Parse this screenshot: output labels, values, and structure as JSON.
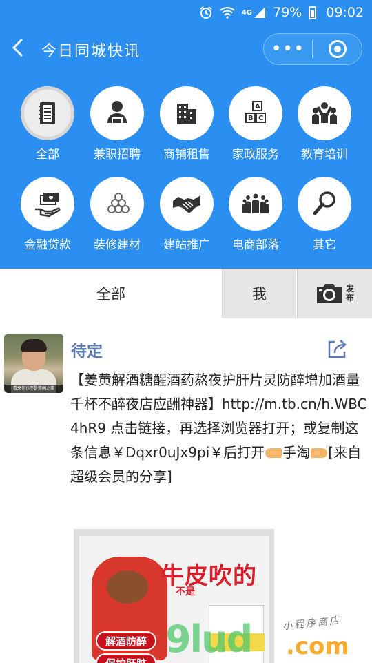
{
  "status_bar": {
    "network": "4G",
    "battery": "79%",
    "time": "09:02",
    "icons": [
      "alarm-icon",
      "wifi-icon",
      "signal-icon",
      "battery-icon"
    ]
  },
  "nav": {
    "title": "今日同城快讯",
    "more_glyph": "•••"
  },
  "categories": [
    {
      "label": "全部",
      "icon": "notebook-icon",
      "active": true
    },
    {
      "label": "兼职招聘",
      "icon": "worker-icon"
    },
    {
      "label": "商铺租售",
      "icon": "buildings-icon"
    },
    {
      "label": "家政服务",
      "icon": "abc-blocks-icon"
    },
    {
      "label": "教育培训",
      "icon": "people-cheer-icon"
    },
    {
      "label": "金融贷款",
      "icon": "money-hand-icon"
    },
    {
      "label": "装修建材",
      "icon": "pipes-icon"
    },
    {
      "label": "建站推广",
      "icon": "handshake-icon"
    },
    {
      "label": "电商部落",
      "icon": "crowd-icon"
    },
    {
      "label": "其它",
      "icon": "magnifier-icon"
    }
  ],
  "tabs": {
    "all": "全部",
    "me": "我",
    "publish": "发布"
  },
  "post": {
    "author": "待定",
    "avatar_caption": "看来你也不是等闲之辈",
    "text_before_emoji1": "【姜黄解酒糖醒酒药熬夜护肝片灵防醉增加酒量千杯不醉夜店应酬神器】http://m.tb.cn/h.WBC4hR9 点击链接，再选择浏览器打开；或复制这条信息￥Dqxr0uJx9pi￥后打开",
    "text_mid": "手淘",
    "text_after_emoji2": "[来自超级会员的分享]",
    "image": {
      "slogan_main": "牛皮吹的",
      "slogan_sub": "不是",
      "badge1": "解酒防醉",
      "badge2": "保护肝脏"
    }
  },
  "watermark": {
    "big": "9lud",
    "com": ".com",
    "small": "小程序商店"
  },
  "colors": {
    "primary_blue": "#2a8ff0",
    "author_blue": "#5c7ab3",
    "tab_gray": "#e6e6e6"
  }
}
